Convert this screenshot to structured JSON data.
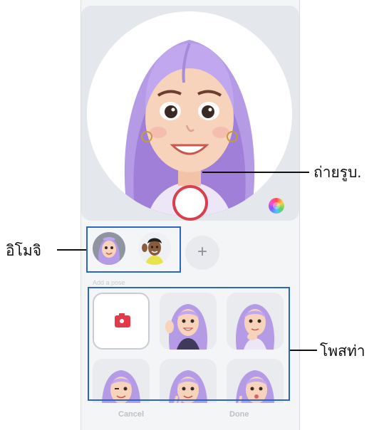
{
  "callouts": {
    "take_photo": "ถ่ายรูบ.",
    "emoji": "อิโมจิ",
    "poses": "โพสท่า"
  },
  "controls": {
    "add": "+",
    "cancel": "Cancel",
    "done": "Done"
  },
  "section": {
    "label": "Add a pose"
  },
  "colors": {
    "shutter_ring": "#d9404f",
    "callout_box": "#2a66c8",
    "record_icon": "#e23a4a"
  }
}
